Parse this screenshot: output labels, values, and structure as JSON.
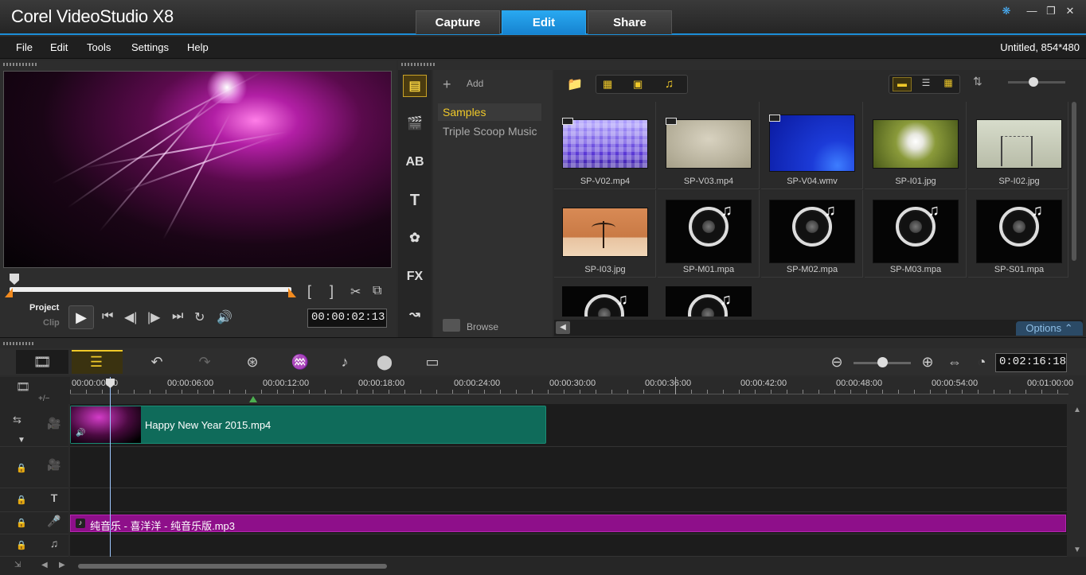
{
  "app": {
    "title": "Corel VideoStudio X8"
  },
  "tabs": [
    {
      "label": "Capture"
    },
    {
      "label": "Edit"
    },
    {
      "label": "Share"
    }
  ],
  "window_controls": {
    "help": "❋",
    "minimize": "—",
    "restore": "❐",
    "close": "✕"
  },
  "menu": {
    "items": [
      "File",
      "Edit",
      "Tools",
      "Settings",
      "Help"
    ]
  },
  "project_info": "Untitled, 854*480",
  "player": {
    "mode_project": "Project",
    "mode_clip": "Clip",
    "timecode": "00:00:02:13",
    "mark_in": "[",
    "mark_out": "]",
    "scrub_position_fraction": 0.02
  },
  "library": {
    "add_label": "Add",
    "browse_label": "Browse",
    "options_label": "Options",
    "folders": [
      "Samples",
      "Triple Scoop Music"
    ],
    "selected_folder": "Samples",
    "items": [
      {
        "name": "SP-V02.mp4",
        "kind": "video"
      },
      {
        "name": "SP-V03.mp4",
        "kind": "video"
      },
      {
        "name": "SP-V04.wmv",
        "kind": "video"
      },
      {
        "name": "SP-I01.jpg",
        "kind": "image"
      },
      {
        "name": "SP-I02.jpg",
        "kind": "image"
      },
      {
        "name": "SP-I03.jpg",
        "kind": "image"
      },
      {
        "name": "SP-M01.mpa",
        "kind": "music"
      },
      {
        "name": "SP-M02.mpa",
        "kind": "music"
      },
      {
        "name": "SP-M03.mpa",
        "kind": "music"
      },
      {
        "name": "SP-S01.mpa",
        "kind": "music"
      }
    ]
  },
  "timeline": {
    "project_duration": "0:02:16:18",
    "ruler_labels": [
      "00:00:00:00",
      "00:00:06:00",
      "00:00:12:00",
      "00:00:18:00",
      "00:00:24:00",
      "00:00:30:00",
      "00:00:36:00",
      "00:00:42:00",
      "00:00:48:00",
      "00:00:54:00",
      "00:01:00:00"
    ],
    "video_clip": "Happy New Year 2015.mp4",
    "audio_clip": "纯音乐 - 喜洋洋 - 纯音乐版.mp3",
    "add_remove_label": "+/−"
  }
}
